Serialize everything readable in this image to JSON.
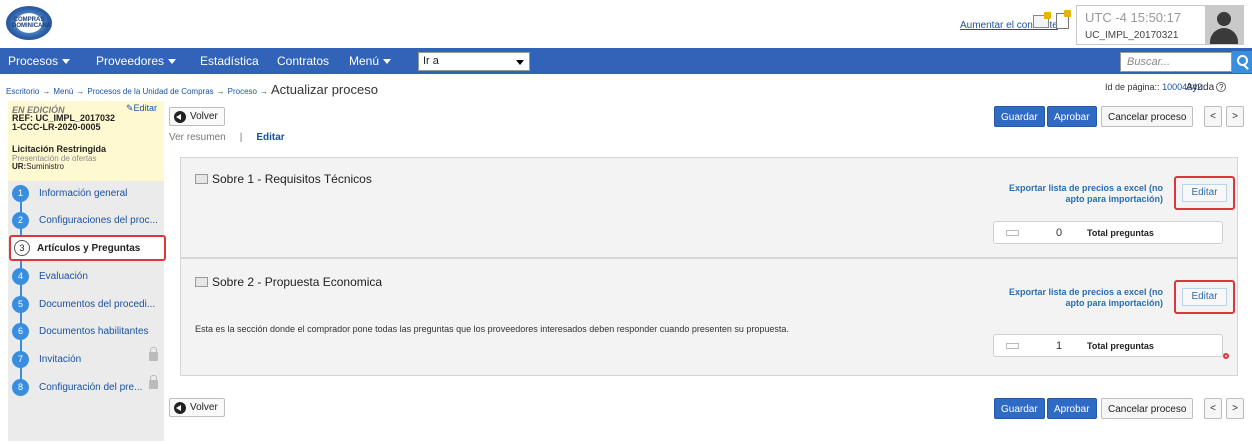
{
  "header": {
    "logo_text": "COMPRAS DOMINICANA",
    "contrast_link": "Aumentar el contraste",
    "time": "UTC -4 15:50:17",
    "user": "UC_IMPL_20170321"
  },
  "nav": {
    "items": [
      {
        "label": "Procesos"
      },
      {
        "label": "Proveedores"
      },
      {
        "label": "Estadística"
      },
      {
        "label": "Contratos"
      },
      {
        "label": "Menú"
      }
    ],
    "goto_value": "Ir a",
    "search_placeholder": "Buscar..."
  },
  "breadcrumb": {
    "items": [
      "Escritorio",
      "Menú",
      "Procesos de la Unidad de Compras",
      "Proceso"
    ],
    "separator": "→",
    "current": "Actualizar proceso"
  },
  "page_id": {
    "label": "Id de página::",
    "value": "10004342"
  },
  "help_label": "Ayuda",
  "process": {
    "status": "EN EDICIÓN",
    "edit_link": "Editar",
    "ref_line1": "REF: UC_IMPL_2017032",
    "ref_line2": "1-CCC-LR-2020-0005",
    "type": "Licitación Restringida",
    "stage": "Presentación de ofertas",
    "ur_label": "UR:",
    "ur_value": "Suministro"
  },
  "steps": [
    {
      "num": "1",
      "label": "Información general",
      "locked": false
    },
    {
      "num": "2",
      "label": "Configuraciones del proc...",
      "locked": false
    },
    {
      "num": "3",
      "label": "Artículos y Preguntas",
      "locked": false,
      "active": true
    },
    {
      "num": "4",
      "label": "Evaluación",
      "locked": false
    },
    {
      "num": "5",
      "label": "Documentos del procedi...",
      "locked": false
    },
    {
      "num": "6",
      "label": "Documentos habilitantes",
      "locked": false
    },
    {
      "num": "7",
      "label": "Invitación",
      "locked": true
    },
    {
      "num": "8",
      "label": "Configuración del pre...",
      "locked": true
    }
  ],
  "actions": {
    "back": "Volver",
    "save": "Guardar",
    "approve": "Aprobar",
    "cancel": "Cancelar proceso",
    "prev": "<",
    "next": ">"
  },
  "tabs": {
    "summary": "Ver resumen",
    "separator": "|",
    "edit": "Editar"
  },
  "sections": [
    {
      "title": "Sobre 1 - Requisitos Técnicos",
      "export": "Exportar lista de precios a excel (no apto para importación)",
      "edit": "Editar",
      "count": "0",
      "count_label": "Total preguntas",
      "description": ""
    },
    {
      "title": "Sobre 2 - Propuesta Economica",
      "export": "Exportar lista de precios a excel (no apto para importación)",
      "edit": "Editar",
      "count": "1",
      "count_label": "Total preguntas",
      "description": "Esta es la sección donde el comprador pone todas las preguntas que los proveedores interesados deben responder cuando presenten su propuesta."
    }
  ],
  "colors": {
    "navbar": "#3164b8",
    "link": "#1a52a3",
    "highlight": "#d9363e",
    "primary_button": "#2f6bc4",
    "info_box": "#fff9d1"
  }
}
